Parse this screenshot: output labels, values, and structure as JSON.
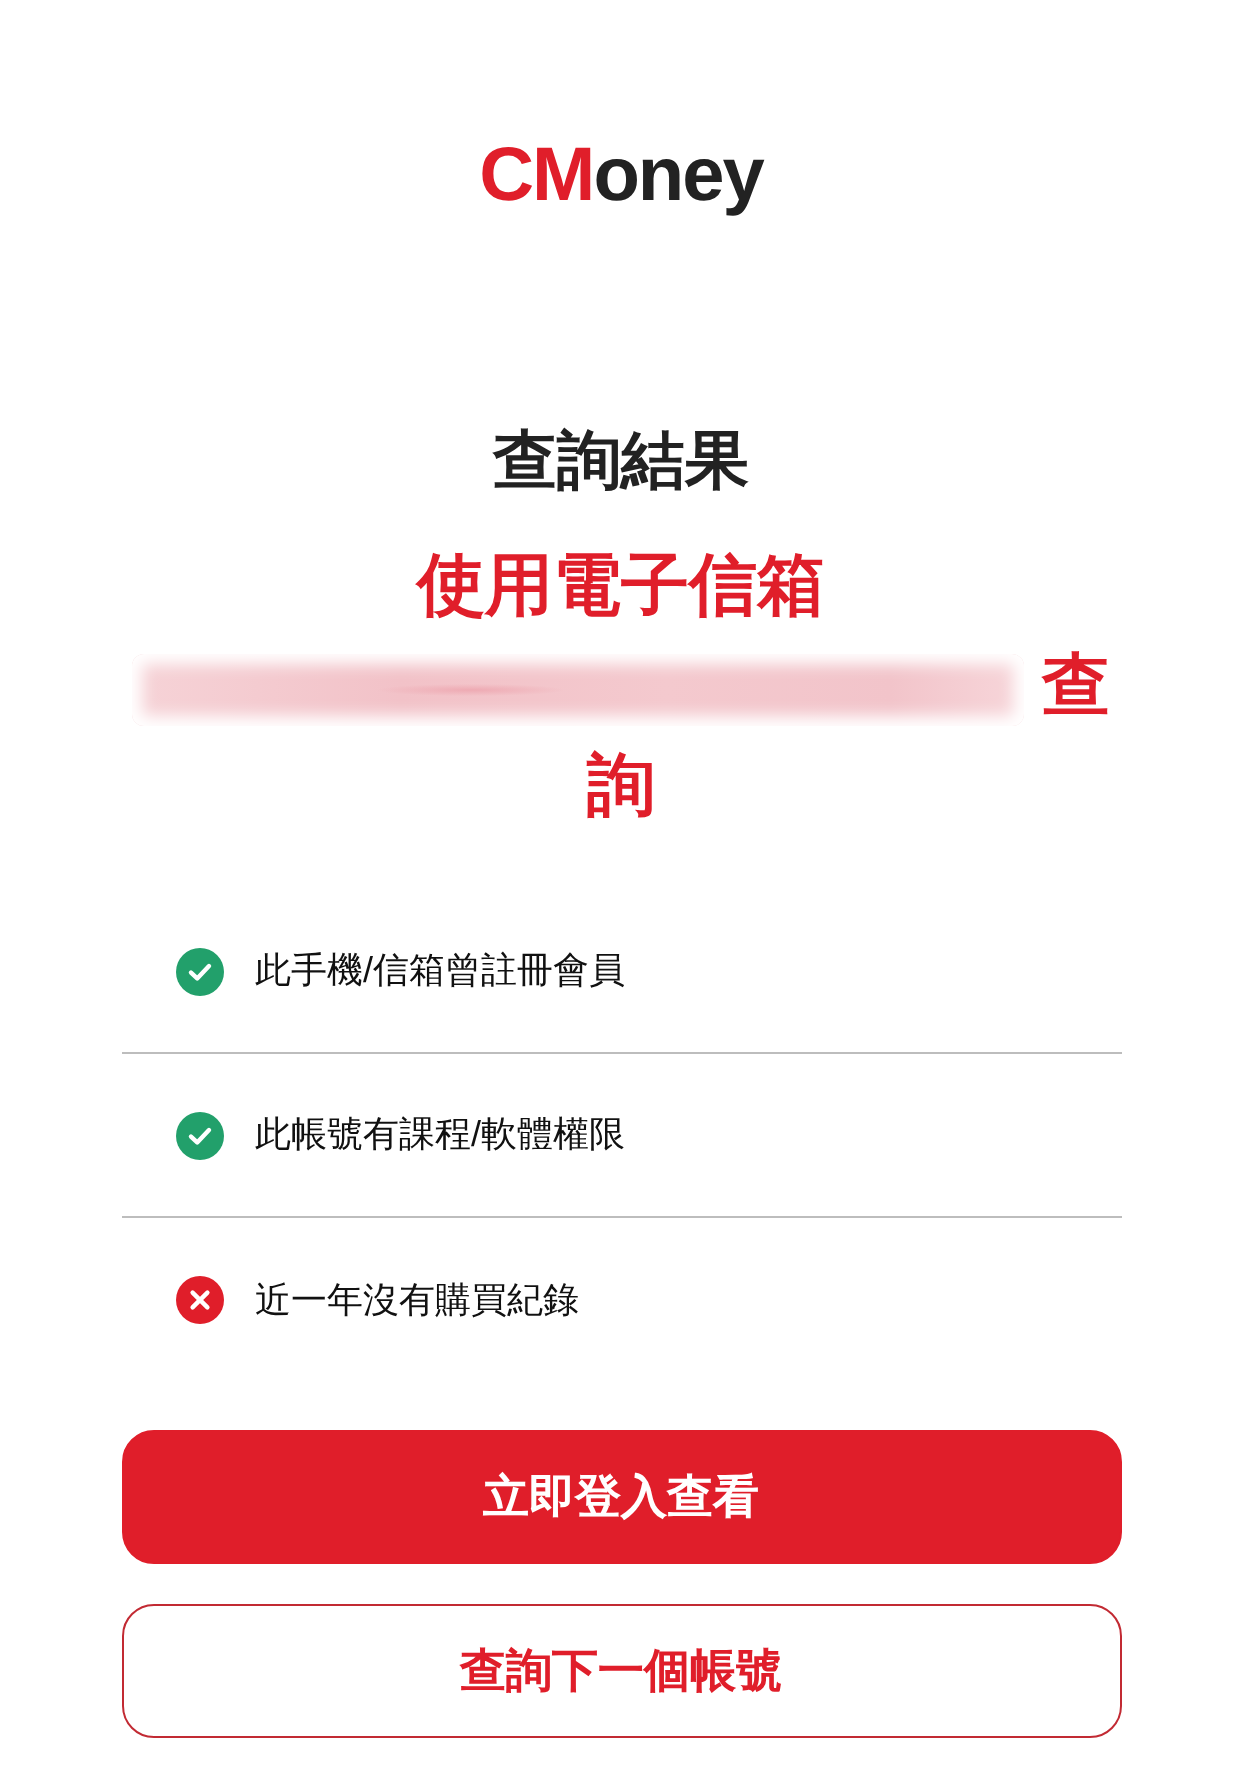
{
  "logo": {
    "accent": "CM",
    "rest": "oney"
  },
  "title": "查詢結果",
  "query": {
    "prefix": "使用電子信箱",
    "email_blurred": true,
    "suffix_parts": [
      "查",
      "詢"
    ]
  },
  "results": [
    {
      "text": "此手機/信箱曾註冊會員",
      "passed": true
    },
    {
      "text": "此帳號有課程/軟體權限",
      "passed": true
    },
    {
      "text": "近一年沒有購買紀錄",
      "passed": false
    }
  ],
  "buttons": [
    {
      "label": "立即登入查看",
      "kind": "primary"
    },
    {
      "label": "查詢下一個帳號",
      "kind": "outline"
    }
  ]
}
